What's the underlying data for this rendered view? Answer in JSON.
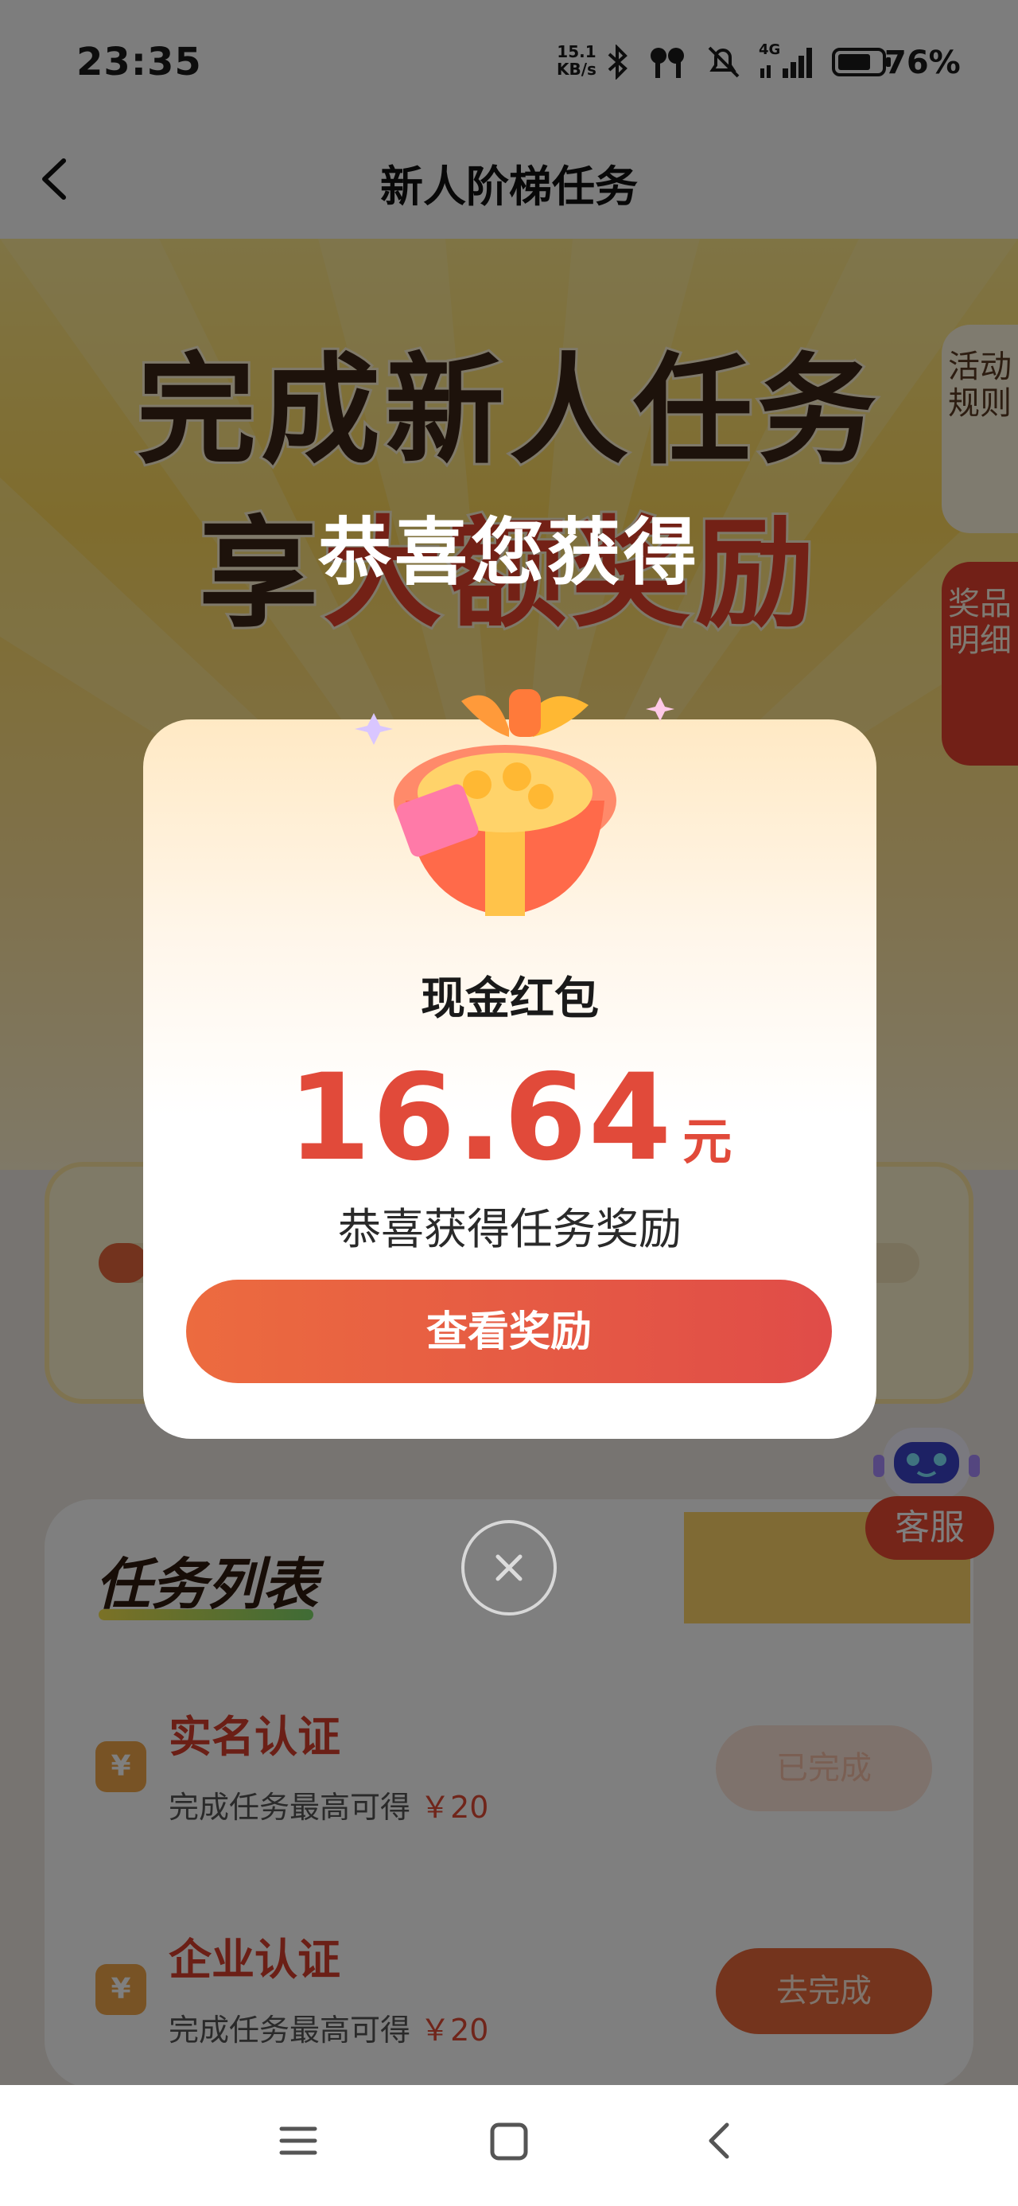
{
  "status_bar": {
    "time": "23:35",
    "net_speed_value": "15.1",
    "net_speed_unit": "KB/s",
    "network_type": "4G",
    "battery_percent": "76%"
  },
  "nav": {
    "title": "新人阶梯任务"
  },
  "hero": {
    "line1": "完成新人任务",
    "line2_prefix": "享",
    "line2_highlight": "大额奖励"
  },
  "side_tabs": {
    "rules": "活动规则",
    "prizes": "奖品明细"
  },
  "progress": {
    "fraction": 0.06
  },
  "task_list": {
    "title": "任务列表",
    "items": [
      {
        "name": "实名认证",
        "desc": "完成任务最高可得",
        "amount": "￥20",
        "button": "已完成"
      },
      {
        "name": "企业认证",
        "desc": "完成任务最高可得",
        "amount": "￥20",
        "button": "去完成"
      }
    ]
  },
  "customer_service": {
    "label": "客服"
  },
  "modal": {
    "title": "恭喜您获得",
    "reward_type": "现金红包",
    "amount": "16.64",
    "unit": "元",
    "message": "恭喜获得任务奖励",
    "button": "查看奖励",
    "coin_icon_label": "¥"
  },
  "colors": {
    "accent_red": "#e14a3a",
    "button_gradient_start": "#ec6b3f",
    "button_gradient_end": "#e04c48",
    "hero_yellow": "#ffd95b"
  }
}
